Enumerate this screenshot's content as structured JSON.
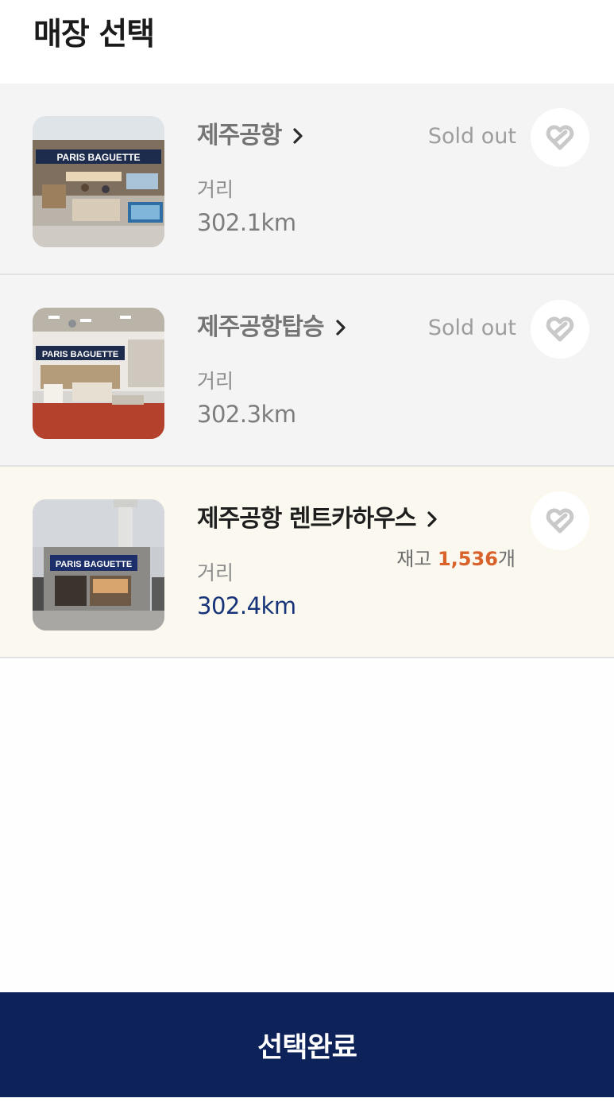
{
  "header": {
    "title": "매장 선택"
  },
  "stores": [
    {
      "name": "제주공항",
      "distance_label": "거리",
      "distance": "302.1km",
      "status": "Sold out",
      "sign_text": "PARIS BAGUETTE",
      "selected": false
    },
    {
      "name": "제주공항탑승",
      "distance_label": "거리",
      "distance": "302.3km",
      "status": "Sold out",
      "sign_text": "PARIS BAGUETTE",
      "selected": false
    },
    {
      "name": "제주공항 렌트카하우스",
      "distance_label": "거리",
      "distance": "302.4km",
      "stock_prefix": "재고 ",
      "stock_count": "1,536",
      "stock_suffix": "개",
      "sign_text": "PARIS BAGUETTE",
      "selected": true
    }
  ],
  "icons": {
    "chevron": "chevron-right-icon",
    "favorite": "heart-outline-icon"
  },
  "colors": {
    "primary_navy": "#0d2259",
    "distance_selected": "#17347a",
    "stock_accent": "#d9622b",
    "selected_bg": "#fbf9ef",
    "unselected_bg": "#f4f4f4"
  },
  "footer": {
    "confirm_label": "선택완료"
  }
}
